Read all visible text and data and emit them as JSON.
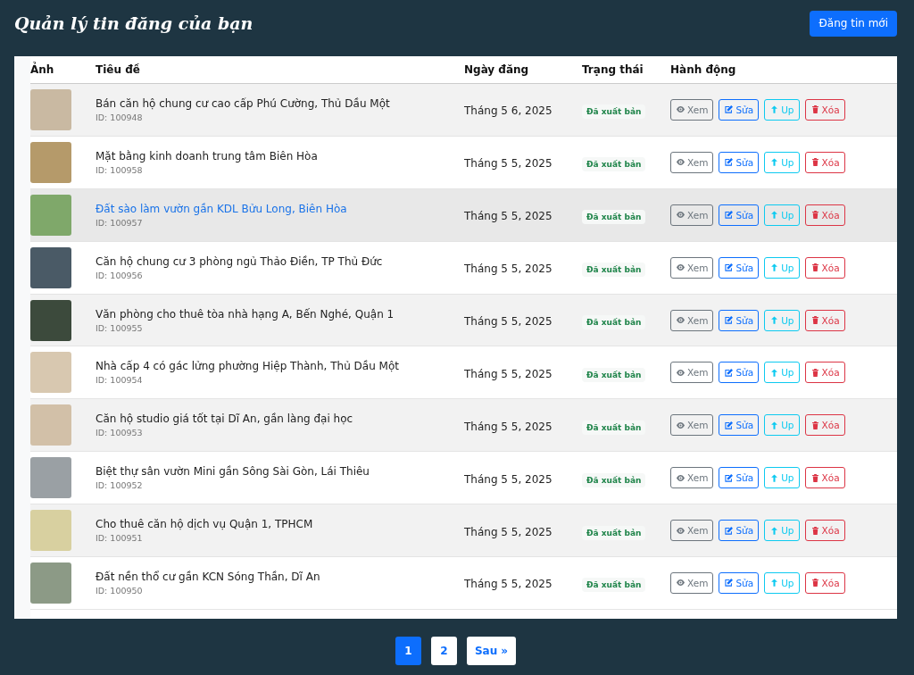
{
  "header": {
    "title": "Quản lý tin đăng của bạn",
    "new_button": "Đăng tin mới"
  },
  "table": {
    "columns": [
      "Ảnh",
      "Tiêu đề",
      "Ngày đăng",
      "Trạng thái",
      "Hành động"
    ],
    "rows": [
      {
        "title": "Bán căn hộ chung cư cao cấp Phú Cường, Thủ Dầu Một",
        "id": "ID: 100948",
        "date": "Tháng 5 6, 2025",
        "status": "Đã xuất bản",
        "hovered": false,
        "actions": [
          {
            "kind": "view",
            "label": "Xem"
          },
          {
            "kind": "edit",
            "label": "Sửa"
          },
          {
            "kind": "up",
            "label": "Up"
          },
          {
            "kind": "delete",
            "label": "Xóa"
          }
        ]
      },
      {
        "title": "Mặt bằng kinh doanh trung tâm Biên Hòa",
        "id": "ID: 100958",
        "date": "Tháng 5 5, 2025",
        "status": "Đã xuất bản",
        "hovered": false,
        "actions": [
          {
            "kind": "view",
            "label": "Xem"
          },
          {
            "kind": "edit",
            "label": "Sửa"
          },
          {
            "kind": "up",
            "label": "Up"
          },
          {
            "kind": "delete",
            "label": "Xóa"
          }
        ]
      },
      {
        "title": "Đất sào làm vườn gần KDL Bửu Long, Biên Hòa",
        "id": "ID: 100957",
        "date": "Tháng 5 5, 2025",
        "status": "Đã xuất bản",
        "hovered": true,
        "actions": [
          {
            "kind": "view",
            "label": "Xem"
          },
          {
            "kind": "edit",
            "label": "Sửa"
          },
          {
            "kind": "up",
            "label": "Up"
          },
          {
            "kind": "delete",
            "label": "Xóa"
          }
        ]
      },
      {
        "title": "Căn hộ chung cư 3 phòng ngủ Thảo Điền, TP Thủ Đức",
        "id": "ID: 100956",
        "date": "Tháng 5 5, 2025",
        "status": "Đã xuất bản",
        "hovered": false,
        "actions": [
          {
            "kind": "view",
            "label": "Xem"
          },
          {
            "kind": "edit",
            "label": "Sửa"
          },
          {
            "kind": "up",
            "label": "Up"
          },
          {
            "kind": "delete",
            "label": "Xóa"
          }
        ]
      },
      {
        "title": "Văn phòng cho thuê tòa nhà hạng A, Bến Nghé, Quận 1",
        "id": "ID: 100955",
        "date": "Tháng 5 5, 2025",
        "status": "Đã xuất bản",
        "hovered": false,
        "actions": [
          {
            "kind": "view",
            "label": "Xem"
          },
          {
            "kind": "edit",
            "label": "Sửa"
          },
          {
            "kind": "up",
            "label": "Up"
          },
          {
            "kind": "delete",
            "label": "Xóa"
          }
        ]
      },
      {
        "title": "Nhà cấp 4 có gác lửng phường Hiệp Thành, Thủ Dầu Một",
        "id": "ID: 100954",
        "date": "Tháng 5 5, 2025",
        "status": "Đã xuất bản",
        "hovered": false,
        "actions": [
          {
            "kind": "view",
            "label": "Xem"
          },
          {
            "kind": "edit",
            "label": "Sửa"
          },
          {
            "kind": "up",
            "label": "Up"
          },
          {
            "kind": "delete",
            "label": "Xóa"
          }
        ]
      },
      {
        "title": "Căn hộ studio giá tốt tại Dĩ An, gần làng đại học",
        "id": "ID: 100953",
        "date": "Tháng 5 5, 2025",
        "status": "Đã xuất bản",
        "hovered": false,
        "actions": [
          {
            "kind": "view",
            "label": "Xem"
          },
          {
            "kind": "edit",
            "label": "Sửa"
          },
          {
            "kind": "up",
            "label": "Up"
          },
          {
            "kind": "delete",
            "label": "Xóa"
          }
        ]
      },
      {
        "title": "Biệt thự sân vườn Mini gần Sông Sài Gòn, Lái Thiêu",
        "id": "ID: 100952",
        "date": "Tháng 5 5, 2025",
        "status": "Đã xuất bản",
        "hovered": false,
        "actions": [
          {
            "kind": "view",
            "label": "Xem"
          },
          {
            "kind": "edit",
            "label": "Sửa"
          },
          {
            "kind": "up",
            "label": "Up"
          },
          {
            "kind": "delete",
            "label": "Xóa"
          }
        ]
      },
      {
        "title": "Cho thuê căn hộ dịch vụ Quận 1, TPHCM",
        "id": "ID: 100951",
        "date": "Tháng 5 5, 2025",
        "status": "Đã xuất bản",
        "hovered": false,
        "actions": [
          {
            "kind": "view",
            "label": "Xem"
          },
          {
            "kind": "edit",
            "label": "Sửa"
          },
          {
            "kind": "up",
            "label": "Up"
          },
          {
            "kind": "delete",
            "label": "Xóa"
          }
        ]
      },
      {
        "title": "Đất nền thổ cư gần KCN Sóng Thần, Dĩ An",
        "id": "ID: 100950",
        "date": "Tháng 5 5, 2025",
        "status": "Đã xuất bản",
        "hovered": false,
        "actions": [
          {
            "kind": "view",
            "label": "Xem"
          },
          {
            "kind": "edit",
            "label": "Sửa"
          },
          {
            "kind": "up",
            "label": "Up"
          },
          {
            "kind": "delete",
            "label": "Xóa"
          }
        ]
      }
    ]
  },
  "pagination": [
    {
      "label": "1",
      "selected": true
    },
    {
      "label": "2",
      "selected": false
    },
    {
      "label": "Sau »",
      "selected": false
    }
  ]
}
